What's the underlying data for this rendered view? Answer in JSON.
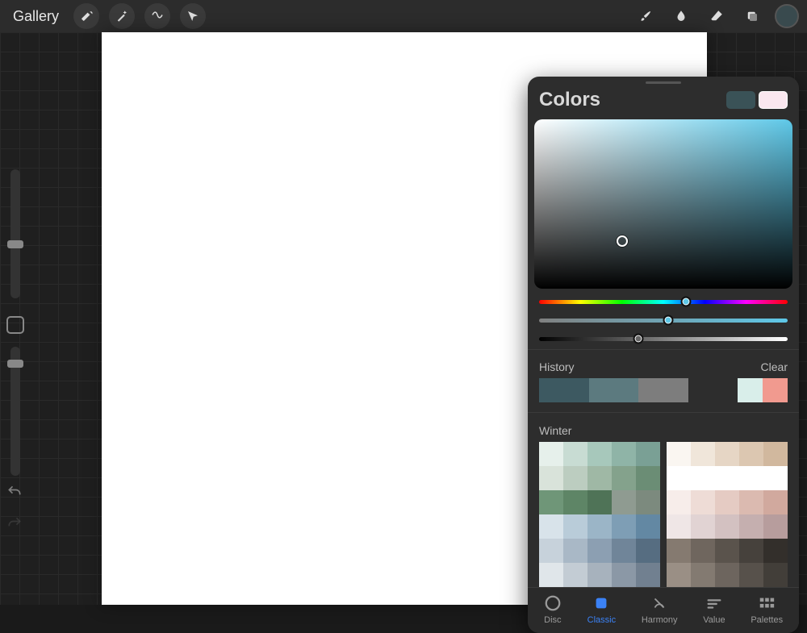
{
  "topbar": {
    "gallery_label": "Gallery"
  },
  "panel": {
    "title": "Colors",
    "primary_swatch": "#3a5257",
    "secondary_swatch": "#fae7ef",
    "history_label": "History",
    "clear_label": "Clear",
    "palette_name": "Winter",
    "tabs": {
      "disc": "Disc",
      "classic": "Classic",
      "harmony": "Harmony",
      "value": "Value",
      "palettes": "Palettes"
    },
    "active_tab": "Classic",
    "hue_slider_pos": 0.59,
    "sat_slider_pos": 0.52,
    "val_slider_pos": 0.4,
    "history_colors": [
      "#3d5961",
      "#3d5961",
      "#5c7a7f",
      "#5c7a7f",
      "#7d7d7d",
      "#7d7d7d",
      "",
      "",
      "#d9eeea",
      "#f19a8f"
    ],
    "winter_left": [
      "#e6f0eb",
      "#c8dcd3",
      "#a7c8bb",
      "#8fb4a7",
      "#7aa095",
      "#d9e3da",
      "#bccdc0",
      "#9fb8a5",
      "#84a28c",
      "#6b8d75",
      "#6f9678",
      "#5e8566",
      "#4f7357",
      "#8f9b91",
      "#7c8a7e",
      "#d8e3ea",
      "#b9ccd9",
      "#9bb5c7",
      "#7e9eb5",
      "#6388a3",
      "#c7d2db",
      "#a9b8c6",
      "#8c9fb2",
      "#708599",
      "#566d81",
      "#e0e6ea",
      "#c3ccd4",
      "#a7b2bd",
      "#8b98a6",
      "#718090"
    ],
    "winter_right": [
      "#faf6f1",
      "#f0e6da",
      "#e6d6c5",
      "#dcc7b1",
      "#d1b89e",
      "#ffffff",
      "#ffffff",
      "#ffffff",
      "#ffffff",
      "#ffffff",
      "#f7edea",
      "#eedcd6",
      "#e5cbc3",
      "#dbbab0",
      "#d1a99e",
      "#efe6e6",
      "#e1d3d3",
      "#d3c1c1",
      "#c5afaf",
      "#b79d9d",
      "#857a70",
      "#6f665e",
      "#5a534c",
      "#46413c",
      "#332f2b",
      "#9a8f85",
      "#837a71",
      "#6d655e",
      "#57514b",
      "#423e39"
    ]
  },
  "side": {
    "brush_size_pos": 0.55,
    "opacity_pos": 0.1
  }
}
